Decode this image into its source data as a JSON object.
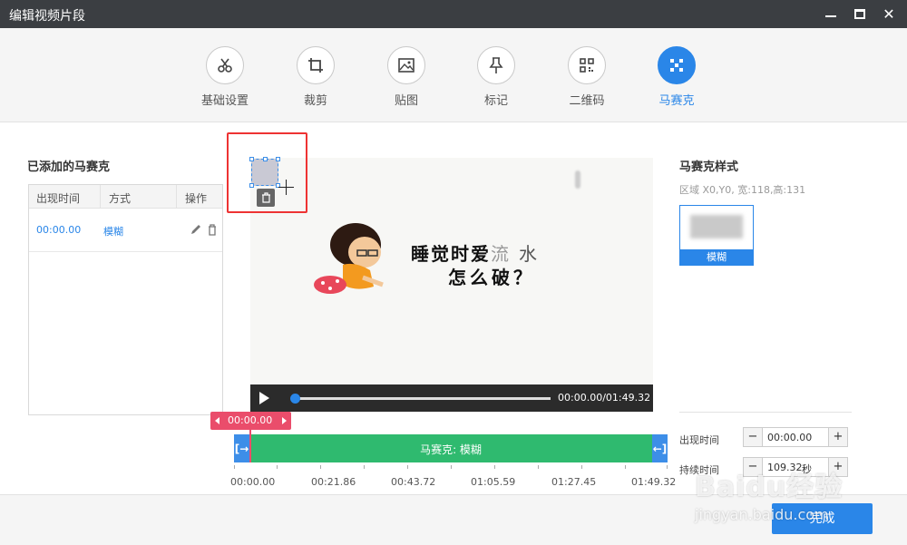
{
  "window": {
    "title": "编辑视频片段"
  },
  "toolbar": {
    "tools": [
      {
        "label": "基础设置",
        "icon": "scissors-icon"
      },
      {
        "label": "裁剪",
        "icon": "crop-icon"
      },
      {
        "label": "贴图",
        "icon": "image-icon"
      },
      {
        "label": "标记",
        "icon": "pin-icon"
      },
      {
        "label": "二维码",
        "icon": "qrcode-icon"
      },
      {
        "label": "马赛克",
        "icon": "mosaic-icon",
        "active": true
      }
    ]
  },
  "left_panel": {
    "title": "已添加的马赛克",
    "columns": [
      "出现时间",
      "方式",
      "操作"
    ],
    "rows": [
      {
        "time": "00:00.00",
        "mode": "模糊"
      }
    ]
  },
  "video": {
    "caption_line1": "睡觉时爱",
    "caption_line1_gray": "流",
    "caption_line1_tail": "水",
    "caption_line2": "怎么破？",
    "time_display": "00:00.00/01:49.32",
    "progress": 0.0
  },
  "timeline": {
    "current_time": "00:00.00",
    "clip_label": "马赛克: 模糊",
    "tick_labels": [
      "00:00.00",
      "00:21.86",
      "00:43.72",
      "01:05.59",
      "01:27.45",
      "01:49.32"
    ]
  },
  "right_panel": {
    "title": "马赛克样式",
    "region": "区域 X0,Y0, 宽:118,高:131",
    "style_card_label": "模糊",
    "start_time_label": "出现时间",
    "start_time_value": "00:00.00",
    "duration_label": "持续时间",
    "duration_value": "109.32",
    "duration_unit": "秒"
  },
  "footer": {
    "done_label": "完成"
  },
  "watermark": {
    "main": "Baidu经验",
    "sub": "jingyan.baidu.com"
  },
  "colors": {
    "accent": "#2a86e8",
    "timeline_green": "#2fba6f",
    "flag_red": "#ea4d6b",
    "titlebar": "#3b3e42",
    "highlight_box": "#e33333"
  }
}
